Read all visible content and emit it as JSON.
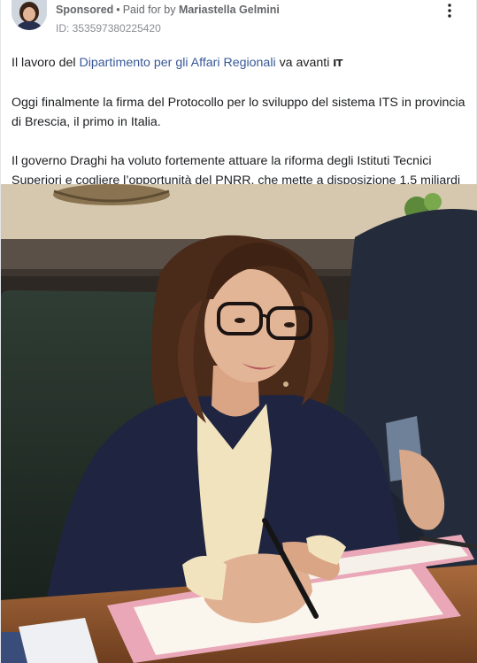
{
  "header": {
    "sponsored_label": "Sponsored",
    "separator": "•",
    "paid_for_label": "Paid for by",
    "payer_name": "Mariastella Gelmini",
    "ad_id": "ID: 353597380225420",
    "more_icon": "more-vertical-icon"
  },
  "post": {
    "p1_prefix": "Il lavoro del ",
    "p1_link": "Dipartimento per gli Affari Regionali",
    "p1_suffix": " va avanti ",
    "p1_flag": "IT",
    "p2": "Oggi finalmente la firma del Protocollo per lo sviluppo del sistema ITS in provincia di Brescia, il primo in Italia.",
    "p3": "Il governo Draghi ha voluto fortemente attuare la riforma degli Istituti Tecnici Superiori e cogliere l’opportunità del PNRR, che mette a disposizione 1,5 miliardi …"
  },
  "colors": {
    "link": "#385898",
    "meta": "#65676b",
    "jacket": "#1f2540",
    "blouse": "#f2e3bf",
    "folder": "#e9a7b8",
    "chair": "#233028"
  }
}
